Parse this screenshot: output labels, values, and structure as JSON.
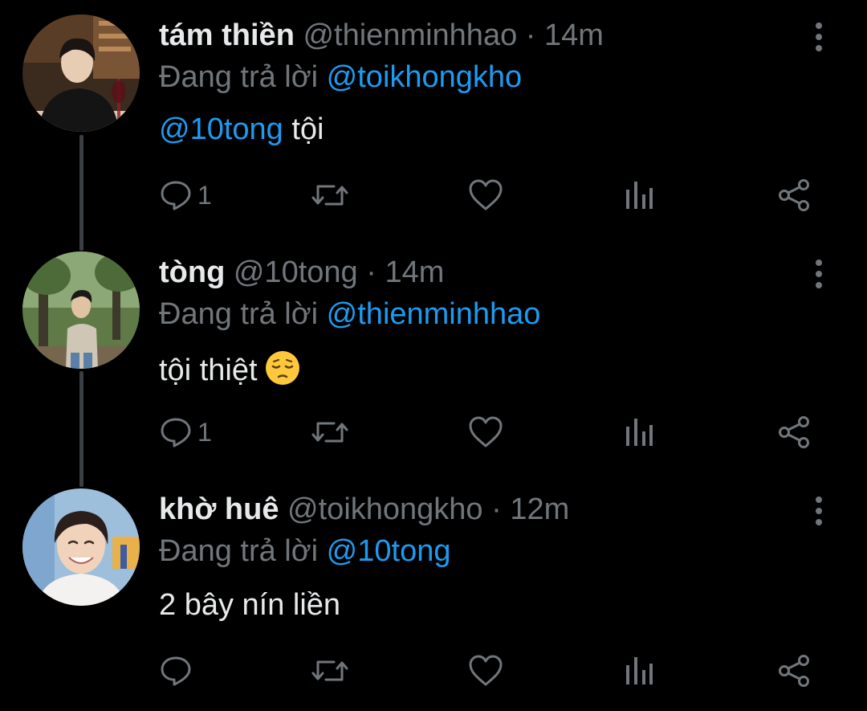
{
  "colors": {
    "background": "#000000",
    "text": "#e7e9ea",
    "muted": "#71767b",
    "link": "#1d9bf0",
    "thread_line": "#3a3f44"
  },
  "tweets": [
    {
      "name": "tám thiền",
      "handle": "@thienminhhao",
      "dot": "·",
      "time": "14m",
      "replying_prefix": "Đang trả lời",
      "replying_to": "@toikhongkho",
      "text_mention": "@10tong",
      "text": " tội",
      "reply_count": "1"
    },
    {
      "name": "tòng",
      "handle": "@10tong",
      "dot": "·",
      "time": "14m",
      "replying_prefix": "Đang trả lời",
      "replying_to": "@thienminhhao",
      "text_mention": "",
      "text": "tội thiệt",
      "emoji": "pensive-face-emoji",
      "reply_count": "1"
    },
    {
      "name": "khờ huê",
      "handle": "@toikhongkho",
      "dot": "·",
      "time": "12m",
      "replying_prefix": "Đang trả lời",
      "replying_to": "@10tong",
      "text_mention": "",
      "text": "2 bây nín liền",
      "reply_count": ""
    }
  ],
  "icons": [
    "reply-icon",
    "retweet-icon",
    "like-icon",
    "analytics-icon",
    "share-icon",
    "more-options-icon"
  ]
}
